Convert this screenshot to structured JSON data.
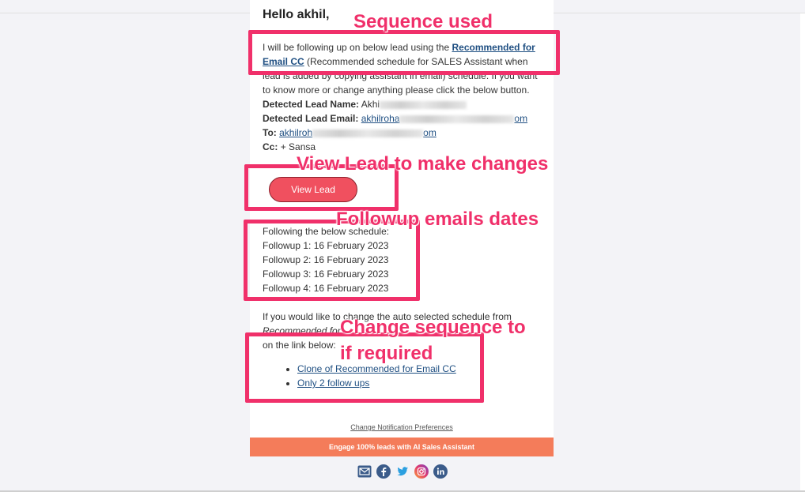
{
  "email": {
    "greeting": "Hello akhil,",
    "intro_text_1": "I will be following up on below lead using the ",
    "sequence_link": "Recommended for Email CC",
    "intro_text_2": " (Recommended schedule for SALES Assistant when lead is added by copying assistant in email) schedule. If you want to know more or change anything please click the below button.",
    "lead_name_label": "Detected Lead Name:",
    "lead_name_value": "Akhi",
    "lead_email_label": "Detected Lead Email:",
    "lead_email_value_start": "akhilroha",
    "lead_email_value_end": "om",
    "to_label": "To:",
    "to_value_start": "akhilroh",
    "to_value_end": "om",
    "cc_label": "Cc:",
    "cc_value": "+ Sansa",
    "view_lead_button": "View Lead",
    "schedule_heading": "Following the below schedule:",
    "followups": [
      "Followup 1: 16 February 2023",
      "Followup 2: 16 February 2023",
      "Followup 3: 16 February 2023",
      "Followup 4: 16 February 2023"
    ],
    "change_text_1": "If you would like to change the auto selected schedule from",
    "change_text_italic": "Recommended for",
    "change_text_2": "on the link below:",
    "alternatives": [
      "Clone of Recommended for Email CC",
      "Only 2 follow ups"
    ],
    "preferences_link": "Change Notification Preferences",
    "footer_banner": "Engage 100% leads with AI Sales Assistant",
    "social_icons": [
      "email-icon",
      "facebook-icon",
      "twitter-icon",
      "instagram-icon",
      "linkedin-icon"
    ]
  },
  "annotations": {
    "sequence_used": "Sequence used",
    "view_lead": "View Lead to make changes",
    "followup_dates": "Followup emails dates",
    "change_sequence_1": "Change sequence to",
    "change_sequence_2": "if required"
  },
  "colors": {
    "annotation": "#f0306a",
    "button": "#f0505f",
    "link": "#1f4f82",
    "banner": "#f47c5a"
  }
}
